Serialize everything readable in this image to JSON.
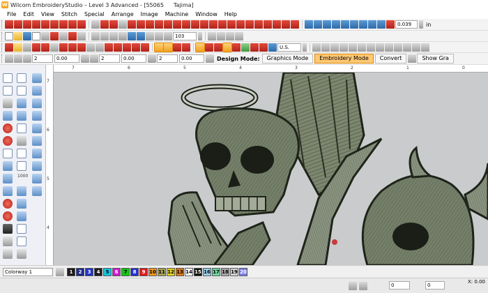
{
  "window": {
    "title": "Wilcom EmbroideryStudio – Level 3 Advanced - [55065",
    "machine": "Tajima]"
  },
  "menu": [
    "File",
    "Edit",
    "View",
    "Stitch",
    "Special",
    "Arrange",
    "Image",
    "Machine",
    "Window",
    "Help"
  ],
  "toolbar1": {
    "value_field": "0.039",
    "unit": "in"
  },
  "toolbar2": {
    "zoom_value": "103"
  },
  "toolbar3": {
    "units": "U.S."
  },
  "toolbar4": {
    "field_a": "2",
    "field_b": "0.00",
    "field_c": "2",
    "field_d": "0.00",
    "field_e": "2",
    "field_f": "0.00",
    "design_mode_label": "Design Mode:",
    "graphics_mode": "Graphics Mode",
    "embroidery_mode": "Embroidery Mode",
    "convert": "Convert",
    "show_graphics": "Show Gra"
  },
  "left_tools": {
    "count_label": "1000"
  },
  "hruler_labels": [
    "7",
    "6",
    "5",
    "4",
    "3",
    "2",
    "1",
    "0"
  ],
  "vruler_labels": [
    "7",
    "6",
    "5",
    "4"
  ],
  "colorbar": {
    "colorway": "Colorway 1",
    "swatches": [
      {
        "n": "1",
        "color": "#1a1a1a",
        "text": "#ffffff"
      },
      {
        "n": "2",
        "color": "#1e2a8f",
        "text": "#ffffff"
      },
      {
        "n": "3",
        "color": "#2434c6",
        "text": "#ffffff"
      },
      {
        "n": "4",
        "color": "#1d1d1d",
        "text": "#ffffff"
      },
      {
        "n": "5",
        "color": "#13c6e0",
        "text": "#000000"
      },
      {
        "n": "6",
        "color": "#d21ad2",
        "text": "#ffffff"
      },
      {
        "n": "7",
        "color": "#1bc21b",
        "text": "#000000"
      },
      {
        "n": "8",
        "color": "#2530d8",
        "text": "#ffffff"
      },
      {
        "n": "9",
        "color": "#e31b1b",
        "text": "#ffffff"
      },
      {
        "n": "10",
        "color": "#f29b1b",
        "text": "#000000"
      },
      {
        "n": "11",
        "color": "#a7a15a",
        "text": "#000000"
      },
      {
        "n": "12",
        "color": "#e3d21b",
        "text": "#000000"
      },
      {
        "n": "13",
        "color": "#d97a1b",
        "text": "#000000"
      },
      {
        "n": "14",
        "color": "#ffffff",
        "text": "#000000"
      },
      {
        "n": "15",
        "color": "#111111",
        "text": "#ffffff"
      },
      {
        "n": "16",
        "color": "#9ad0ea",
        "text": "#000000"
      },
      {
        "n": "17",
        "color": "#6fd99f",
        "text": "#000000"
      },
      {
        "n": "18",
        "color": "#a9a9a9",
        "text": "#000000"
      },
      {
        "n": "19",
        "color": "#d4d4d4",
        "text": "#000000"
      },
      {
        "n": "20",
        "color": "#7e7ee8",
        "text": "#ffffff"
      }
    ]
  },
  "statusbar": {
    "x_label": "X:",
    "x_value": "0.00",
    "field1": "0",
    "field2": "0"
  },
  "colors": {
    "canvas": "#c9cbcc",
    "active_button": "#ffc875",
    "stitch_fill": "#6e7a62",
    "stitch_dark": "#1e241a"
  }
}
